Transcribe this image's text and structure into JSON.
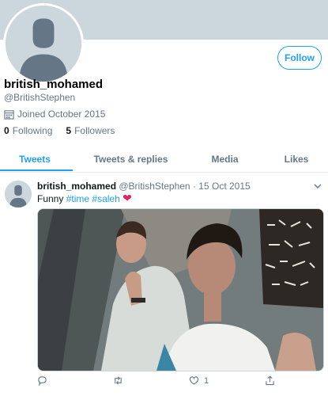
{
  "profile": {
    "display_name": "british_mohamed",
    "handle": "@BritishStephen",
    "joined": "Joined October 2015",
    "following_count": "0",
    "following_label": "Following",
    "followers_count": "5",
    "followers_label": "Followers",
    "follow_label": "Follow"
  },
  "tabs": [
    "Tweets",
    "Tweets & replies",
    "Media",
    "Likes"
  ],
  "active_tab": "Tweets",
  "tweet": {
    "name": "british_mohamed",
    "handle": "@BritishStephen",
    "separator": "·",
    "date": "15 Oct 2015",
    "text_prefix": "Funny",
    "hashtags": [
      "#time",
      "#saleh"
    ],
    "emoji": "❤",
    "like_count": "1"
  },
  "colors": {
    "accent": "#1da1f2",
    "banner": "#ccd6dd",
    "muted_text": "#657786",
    "heart": "#e0245e"
  },
  "icons": [
    "calendar-icon",
    "chevron-down-icon",
    "reply-icon",
    "retweet-icon",
    "like-icon",
    "share-icon",
    "default-avatar-icon"
  ]
}
